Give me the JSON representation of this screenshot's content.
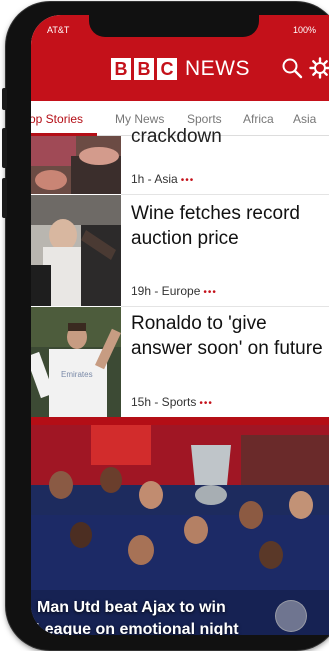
{
  "status_bar": {
    "carrier": "AT&T",
    "battery": "100%"
  },
  "header": {
    "logo_letters": [
      "B",
      "B",
      "C"
    ],
    "logo_word": "NEWS",
    "brand_color": "#c4111a",
    "icons": [
      "search-icon",
      "gear-icon"
    ]
  },
  "tabs": [
    {
      "label": "Top Stories",
      "active": true
    },
    {
      "label": "My News",
      "active": false
    },
    {
      "label": "Sports",
      "active": false
    },
    {
      "label": "Africa",
      "active": false
    },
    {
      "label": "Asia",
      "active": false
    }
  ],
  "stories": [
    {
      "headline": "crackdown",
      "meta": "1h - Asia",
      "dots": "•••"
    },
    {
      "headline": "Wine fetches record auction price",
      "meta": "19h - Europe",
      "dots": "•••"
    },
    {
      "headline": "Ronaldo to 'give answer soon' on future",
      "meta": "15h - Sports",
      "dots": "•••"
    }
  ],
  "hero": {
    "title_line1": "Man Utd beat Ajax to win",
    "title_line2": "League on emotional night"
  }
}
